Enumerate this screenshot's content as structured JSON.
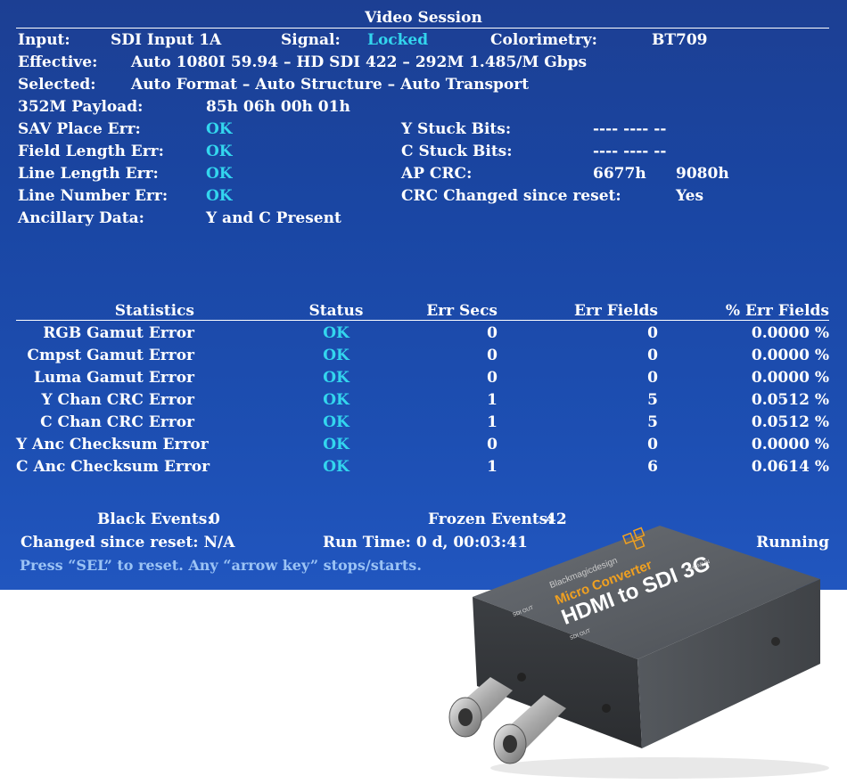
{
  "title": "Video Session",
  "input": {
    "label": "Input:",
    "value": "SDI Input 1A"
  },
  "signal": {
    "label": "Signal:",
    "value": "Locked"
  },
  "colorimetry": {
    "label": "Colorimetry:",
    "value": "BT709"
  },
  "effective": {
    "label": "Effective:",
    "value": "Auto 1080I 59.94 – HD SDI 422 – 292M 1.485/M Gbps"
  },
  "selected": {
    "label": "Selected:",
    "value": "Auto Format – Auto Structure – Auto Transport"
  },
  "payload": {
    "label": "352M Payload:",
    "value": "85h 06h 00h 01h"
  },
  "left_checks": [
    {
      "label": "SAV Place Err:",
      "value": "OK"
    },
    {
      "label": "Field Length Err:",
      "value": "OK"
    },
    {
      "label": "Line Length Err:",
      "value": "OK"
    },
    {
      "label": "Line Number Err:",
      "value": "OK"
    }
  ],
  "ancillary": {
    "label": "Ancillary Data:",
    "value": "Y and C Present"
  },
  "y_stuck": {
    "label": "Y Stuck Bits:",
    "value": "---- ---- --"
  },
  "c_stuck": {
    "label": "C Stuck Bits:",
    "value": "---- ---- --"
  },
  "ap_crc": {
    "label": "AP CRC:",
    "value1": "6677h",
    "value2": "9080h"
  },
  "crc_changed": {
    "label": "CRC Changed since reset:",
    "value": "Yes"
  },
  "stats": {
    "headers": [
      "Statistics",
      "Status",
      "Err Secs",
      "Err Fields",
      "% Err Fields"
    ],
    "rows": [
      {
        "name": "RGB Gamut Error",
        "status": "OK",
        "secs": "0",
        "fields": "0",
        "pct": "0.0000 %"
      },
      {
        "name": "Cmpst Gamut Error",
        "status": "OK",
        "secs": "0",
        "fields": "0",
        "pct": "0.0000 %"
      },
      {
        "name": "Luma Gamut Error",
        "status": "OK",
        "secs": "0",
        "fields": "0",
        "pct": "0.0000 %"
      },
      {
        "name": "Y Chan CRC Error",
        "status": "OK",
        "secs": "1",
        "fields": "5",
        "pct": "0.0512 %"
      },
      {
        "name": "C Chan CRC Error",
        "status": "OK",
        "secs": "1",
        "fields": "5",
        "pct": "0.0512 %"
      },
      {
        "name": "Y Anc Checksum Error",
        "status": "OK",
        "secs": "0",
        "fields": "0",
        "pct": "0.0000 %"
      },
      {
        "name": "C Anc Checksum Error",
        "status": "OK",
        "secs": "1",
        "fields": "6",
        "pct": "0.0614 %"
      }
    ]
  },
  "footer": {
    "black_events_label": "Black Events:",
    "black_events_value": "0",
    "frozen_events_label": "Frozen Events:",
    "frozen_events_value": "42",
    "changed_since_reset": "Changed since reset: N/A",
    "run_time": "Run Time: 0 d, 00:03:41",
    "state": "Running",
    "hint": "Press “SEL” to reset.   Any “arrow key” stops/starts."
  },
  "device": {
    "brand": "Blackmagicdesign",
    "series": "Micro Converter",
    "model": "HDMI to SDI 3G",
    "port_sdi_out_1": "SDI OUT",
    "port_sdi_out_2": "SDI OUT",
    "port_hdmi_in": "HDMI IN",
    "colors": {
      "body": "#4a4d52",
      "top": "#5c6066",
      "accent": "#f0a020"
    }
  }
}
